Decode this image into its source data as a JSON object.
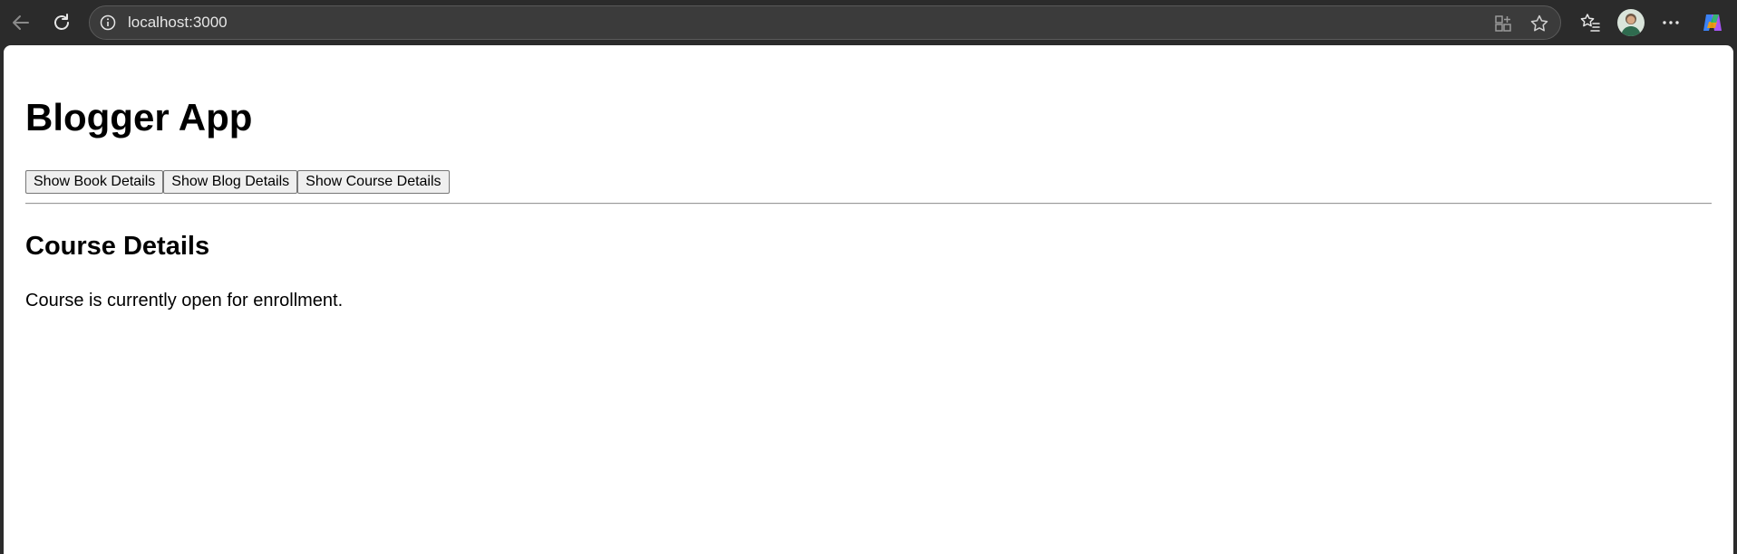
{
  "browser": {
    "url": "localhost:3000"
  },
  "app": {
    "title": "Blogger App",
    "buttons": {
      "book": "Show Book Details",
      "blog": "Show Blog Details",
      "course": "Show Course Details"
    },
    "section": {
      "heading": "Course Details",
      "message": "Course is currently open for enrollment."
    }
  },
  "icons": {
    "back": "back-arrow-icon",
    "refresh": "refresh-icon",
    "info": "info-icon",
    "apps": "app-available-icon",
    "favorite": "favorite-star-icon",
    "favorites_list": "favorites-icon",
    "more": "more-options-icon",
    "copilot": "copilot-icon"
  },
  "colors": {
    "toolbar_bg": "#2b2b2b",
    "address_bg": "#3b3b3b",
    "page_bg": "#ffffff",
    "button_bg": "#efefef"
  }
}
